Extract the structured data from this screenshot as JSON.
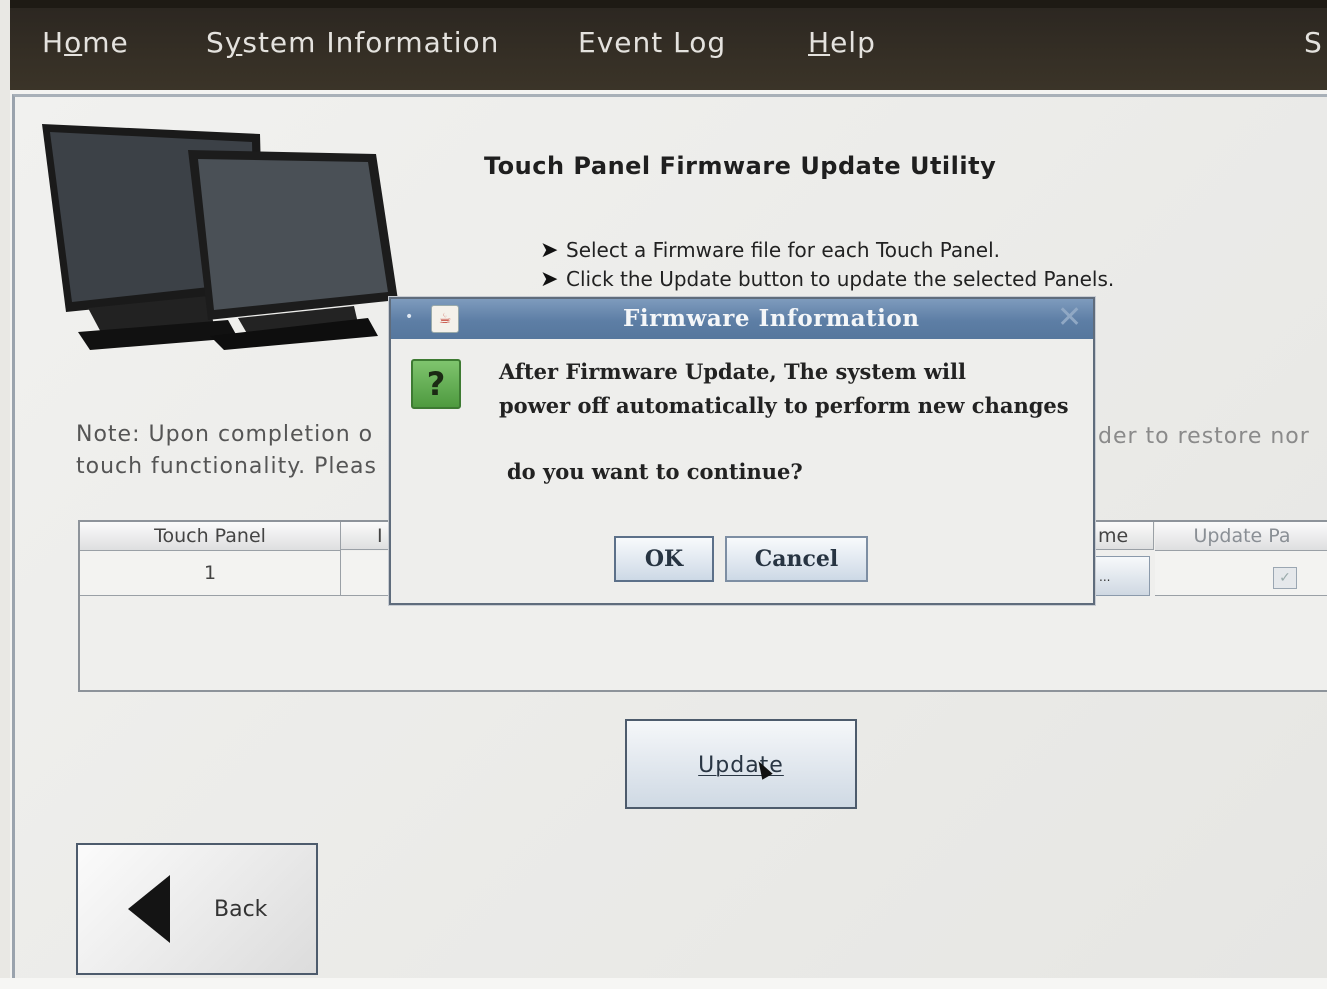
{
  "menubar": {
    "items": [
      {
        "label": "Home",
        "mnemonic_index": 1
      },
      {
        "label": "System Information",
        "mnemonic_index": 1
      },
      {
        "label": "Event Log",
        "mnemonic_index": -1
      },
      {
        "label": "Help",
        "mnemonic_index": 0
      },
      {
        "label": "S",
        "mnemonic_index": -1
      }
    ]
  },
  "page": {
    "title": "Touch Panel Firmware Update Utility",
    "bullets": [
      "Select a Firmware file for each Touch Panel.",
      "Click the Update button to update the selected Panels."
    ],
    "note_lines": [
      "Note: Upon completion o",
      "touch functionality. Pleas"
    ],
    "note_right": "der to restore nor"
  },
  "table": {
    "headers": [
      "Touch Panel",
      "I",
      "me",
      "Update Pa"
    ],
    "rows": [
      {
        "touch_panel": "1",
        "browse_label": "...",
        "update_checked": true
      }
    ]
  },
  "buttons": {
    "update": "Update",
    "back": "Back"
  },
  "dialog": {
    "title": "Firmware Information",
    "message_lines": [
      "After Firmware Update, The system will",
      "power off automatically to perform new changes"
    ],
    "question": "do you want to continue?",
    "ok": "OK",
    "cancel": "Cancel",
    "icon": "question-icon"
  },
  "colors": {
    "menubar_bg": "#2c2721",
    "dialog_titlebar": "#6a89ae",
    "question_icon": "#5fae4c"
  }
}
